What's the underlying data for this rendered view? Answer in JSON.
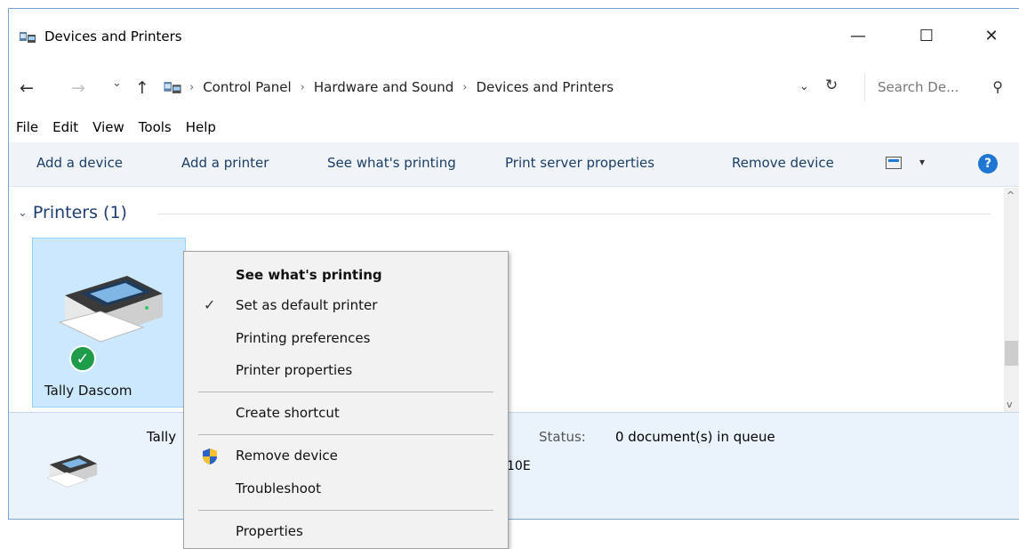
{
  "window": {
    "title": "Devices and Printers",
    "controls": {
      "minimize": "—",
      "maximize": "☐",
      "close": "✕"
    }
  },
  "address": {
    "back": "←",
    "forward": "→",
    "recent": "⌄",
    "up": "↑",
    "separator": "›",
    "crumbs": [
      "Control Panel",
      "Hardware and Sound",
      "Devices and Printers"
    ],
    "dropdown": "⌄",
    "refresh": "↻",
    "search_placeholder": "Search De...",
    "search_icon": "⚲"
  },
  "menubar": [
    "File",
    "Edit",
    "View",
    "Tools",
    "Help"
  ],
  "commandbar": {
    "items": [
      "Add a device",
      "Add a printer",
      "See what's printing",
      "Print server properties",
      "Remove device"
    ],
    "view_dropdown": "▾",
    "help": "?"
  },
  "content": {
    "group_chevron": "⌄",
    "group_title": "Printers (1)",
    "device": {
      "name": "Tally Dascom",
      "status_icon": "✓"
    },
    "scroll_up": "^",
    "scroll_down": "v"
  },
  "details": {
    "name": "Tally",
    "status_label": "Status:",
    "status_value": "0 document(s) in queue",
    "model_fragment": "10E"
  },
  "context_menu": {
    "items": [
      {
        "label": "See what's printing",
        "bold": true
      },
      {
        "label": "Set as default printer",
        "checked": true
      },
      {
        "label": "Printing preferences"
      },
      {
        "label": "Printer properties"
      },
      {
        "label": "Create shortcut"
      },
      {
        "label": "Remove device",
        "icon": "shield-icon"
      },
      {
        "label": "Troubleshoot"
      },
      {
        "label": "Properties"
      }
    ],
    "check_glyph": "✓"
  },
  "colors": {
    "accent": "#1f76d3",
    "selection": "#cce8ff",
    "ok": "#1e9c4a",
    "link": "#1b3e68"
  }
}
